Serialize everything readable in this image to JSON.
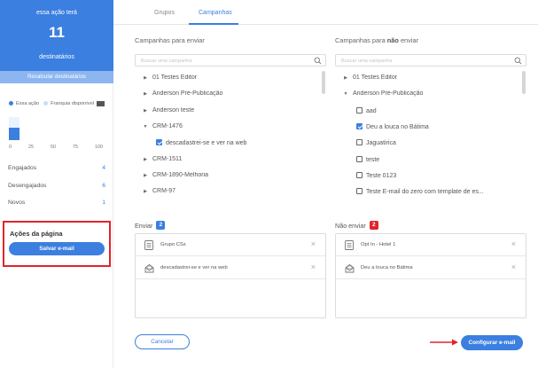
{
  "colors": {
    "primary": "#3b7fe0",
    "primary_light": "#8db6f0",
    "franquia": "#c8dcf7",
    "highlight_red": "#e0252b"
  },
  "sidebar": {
    "hero": {
      "line1": "essa ação terá",
      "count": "11",
      "line2": "destinatários"
    },
    "recalc_label": "Recalcular destinatários",
    "legend": {
      "this_action": "Essa ação",
      "franchise": "Franquia disponível",
      "menu_icon": "menu-icon"
    },
    "chart": {
      "type": "bar",
      "series": [
        {
          "name": "Essa ação",
          "value": 11
        }
      ],
      "xlim": [
        0,
        100
      ],
      "ticks": [
        "0",
        "25",
        "50",
        "75",
        "100"
      ]
    },
    "stats": [
      {
        "label": "Engajados",
        "value": "4"
      },
      {
        "label": "Desengajados",
        "value": "6"
      },
      {
        "label": "Novos",
        "value": "1"
      }
    ],
    "page_actions": {
      "title": "Ações da página",
      "save_button": "Salvar e-mail"
    }
  },
  "main": {
    "tabs": [
      {
        "label": "Grupos",
        "active": false
      },
      {
        "label": "Campanhas",
        "active": true
      }
    ],
    "left_column": {
      "title": "Campanhas para enviar",
      "search_placeholder": "Buscar uma campanha",
      "items": [
        {
          "type": "folder",
          "expanded": false,
          "label": "01 Testes Editor"
        },
        {
          "type": "folder",
          "expanded": false,
          "label": "Anderson Pré-Publicação"
        },
        {
          "type": "folder",
          "expanded": false,
          "label": "Anderson teste"
        },
        {
          "type": "folder",
          "expanded": true,
          "label": "CRM-1476"
        },
        {
          "type": "check",
          "checked": true,
          "label": "descadastrei-se e ver na web"
        },
        {
          "type": "folder",
          "expanded": false,
          "label": "CRM-1511"
        },
        {
          "type": "folder",
          "expanded": false,
          "label": "CRM-1890-Melhoria"
        },
        {
          "type": "folder",
          "expanded": false,
          "label": "CRM-97"
        }
      ]
    },
    "right_column": {
      "title_prefix": "Campanhas para ",
      "title_strong": "não",
      "title_suffix": " enviar",
      "search_placeholder": "Buscar uma campanha",
      "items": [
        {
          "type": "folder",
          "expanded": false,
          "label": "01 Testes Editor"
        },
        {
          "type": "folder",
          "expanded": true,
          "label": "Anderson Pré-Publicação"
        },
        {
          "type": "check",
          "checked": false,
          "label": "aad"
        },
        {
          "type": "check",
          "checked": true,
          "label": "Deu a louca no Bátima"
        },
        {
          "type": "check",
          "checked": false,
          "label": "Jaguatirica"
        },
        {
          "type": "check",
          "checked": false,
          "label": "teste"
        },
        {
          "type": "check",
          "checked": false,
          "label": "Teste 0123"
        },
        {
          "type": "check",
          "checked": false,
          "label": "Teste E-mail do zero com template de es..."
        }
      ]
    },
    "send_list": {
      "title": "Enviar",
      "count": "2",
      "rows": [
        {
          "icon": "list-icon",
          "label": "Grupo CSs"
        },
        {
          "icon": "mail-stack-icon",
          "label": "descadastrei-se e ver na web"
        }
      ]
    },
    "dont_send_list": {
      "title": "Não enviar",
      "count": "2",
      "rows": [
        {
          "icon": "list-icon",
          "label": "Opt In - Hotel 1"
        },
        {
          "icon": "mail-stack-icon",
          "label": "Deu a louca no Bátima"
        }
      ]
    },
    "close_glyph": "×",
    "cancel_button": "Cancelar",
    "configure_button": "Configurar e-mail"
  }
}
